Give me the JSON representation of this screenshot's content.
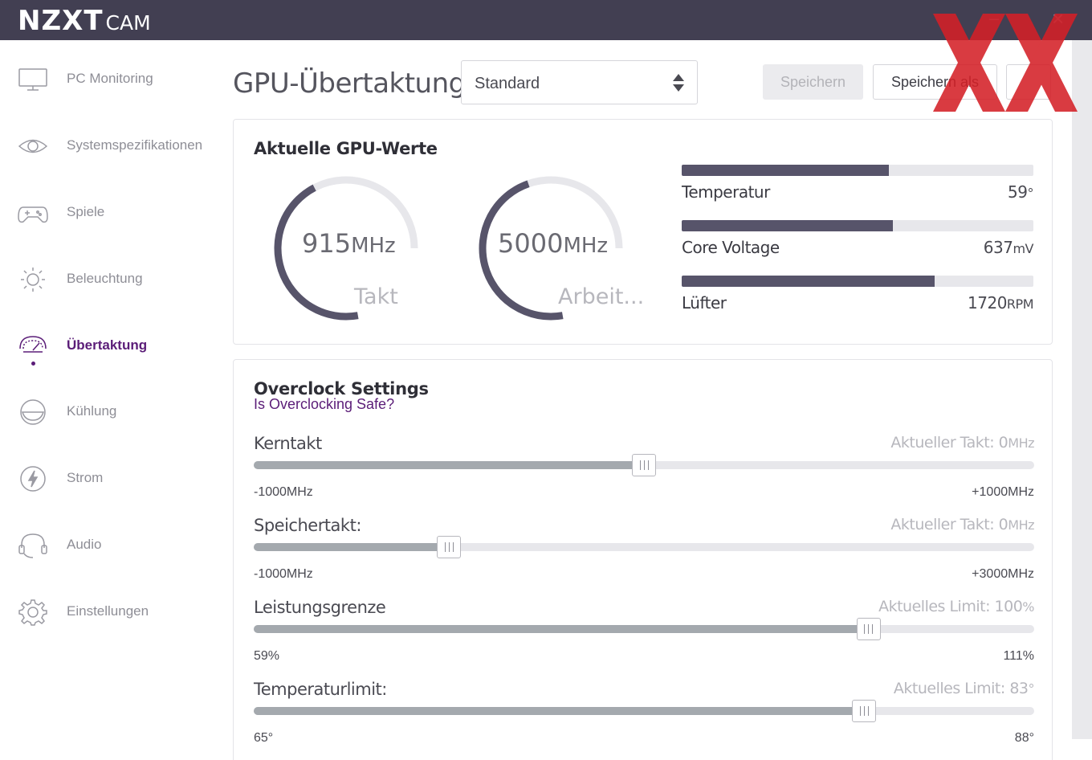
{
  "app": {
    "logo_main": "NZXT",
    "logo_sub": "CAM",
    "window_minimize": "–",
    "window_close": "×"
  },
  "sidebar": {
    "items": [
      {
        "label": "PC Monitoring",
        "icon": "monitor-icon",
        "active": false
      },
      {
        "label": "Systemspezifikationen",
        "icon": "eye-icon",
        "active": false
      },
      {
        "label": "Spiele",
        "icon": "gamepad-icon",
        "active": false
      },
      {
        "label": "Beleuchtung",
        "icon": "sun-icon",
        "active": false
      },
      {
        "label": "Übertaktung",
        "icon": "speedometer-icon",
        "active": true
      },
      {
        "label": "Kühlung",
        "icon": "fan-icon",
        "active": false
      },
      {
        "label": "Strom",
        "icon": "lightning-icon",
        "active": false
      },
      {
        "label": "Audio",
        "icon": "headset-icon",
        "active": false
      },
      {
        "label": "Einstellungen",
        "icon": "gear-icon",
        "active": false
      }
    ]
  },
  "header": {
    "title": "GPU-Übertaktung",
    "profile": "Standard",
    "save_label": "Speichern",
    "save_as_label": "Speichern als"
  },
  "gpu_values": {
    "title": "Aktuelle GPU-Werte",
    "core_clock": {
      "value": "915",
      "unit": "MHz",
      "label": "Takt",
      "fraction": 0.58
    },
    "memory_clock": {
      "value": "5000",
      "unit": "MHz",
      "label": "Arbeit...",
      "fraction": 0.61
    },
    "stats": [
      {
        "label": "Temperatur",
        "value": "59",
        "unit": "°",
        "fraction": 0.59
      },
      {
        "label": "Core Voltage",
        "value": "637",
        "unit": "mV",
        "fraction": 0.6
      },
      {
        "label": "Lüfter",
        "value": "1720",
        "unit": "RPM",
        "fraction": 0.72
      }
    ]
  },
  "overclock": {
    "title": "Overclock Settings",
    "link": "Is Overclocking Safe?",
    "sliders": [
      {
        "name": "Kerntakt",
        "current_prefix": "Aktueller Takt: 0",
        "current_unit": "MHz",
        "min": "-1000MHz",
        "max": "+1000MHz",
        "fraction": 0.5
      },
      {
        "name": "Speichertakt:",
        "current_prefix": "Aktueller Takt: 0",
        "current_unit": "MHz",
        "min": "-1000MHz",
        "max": "+3000MHz",
        "fraction": 0.25
      },
      {
        "name": "Leistungsgrenze",
        "current_prefix": "Aktuelles Limit: 100",
        "current_unit": "%",
        "min": "59%",
        "max": "111%",
        "fraction": 0.788
      },
      {
        "name": "Temperaturlimit:",
        "current_prefix": "Aktuelles Limit: 83",
        "current_unit": "°",
        "min": "65°",
        "max": "88°",
        "fraction": 0.782
      }
    ]
  },
  "colors": {
    "titlebar": "#423f52",
    "accent_purple": "#5b1d78",
    "gauge_fill": "#57546a",
    "watermark_red": "#d42027"
  }
}
